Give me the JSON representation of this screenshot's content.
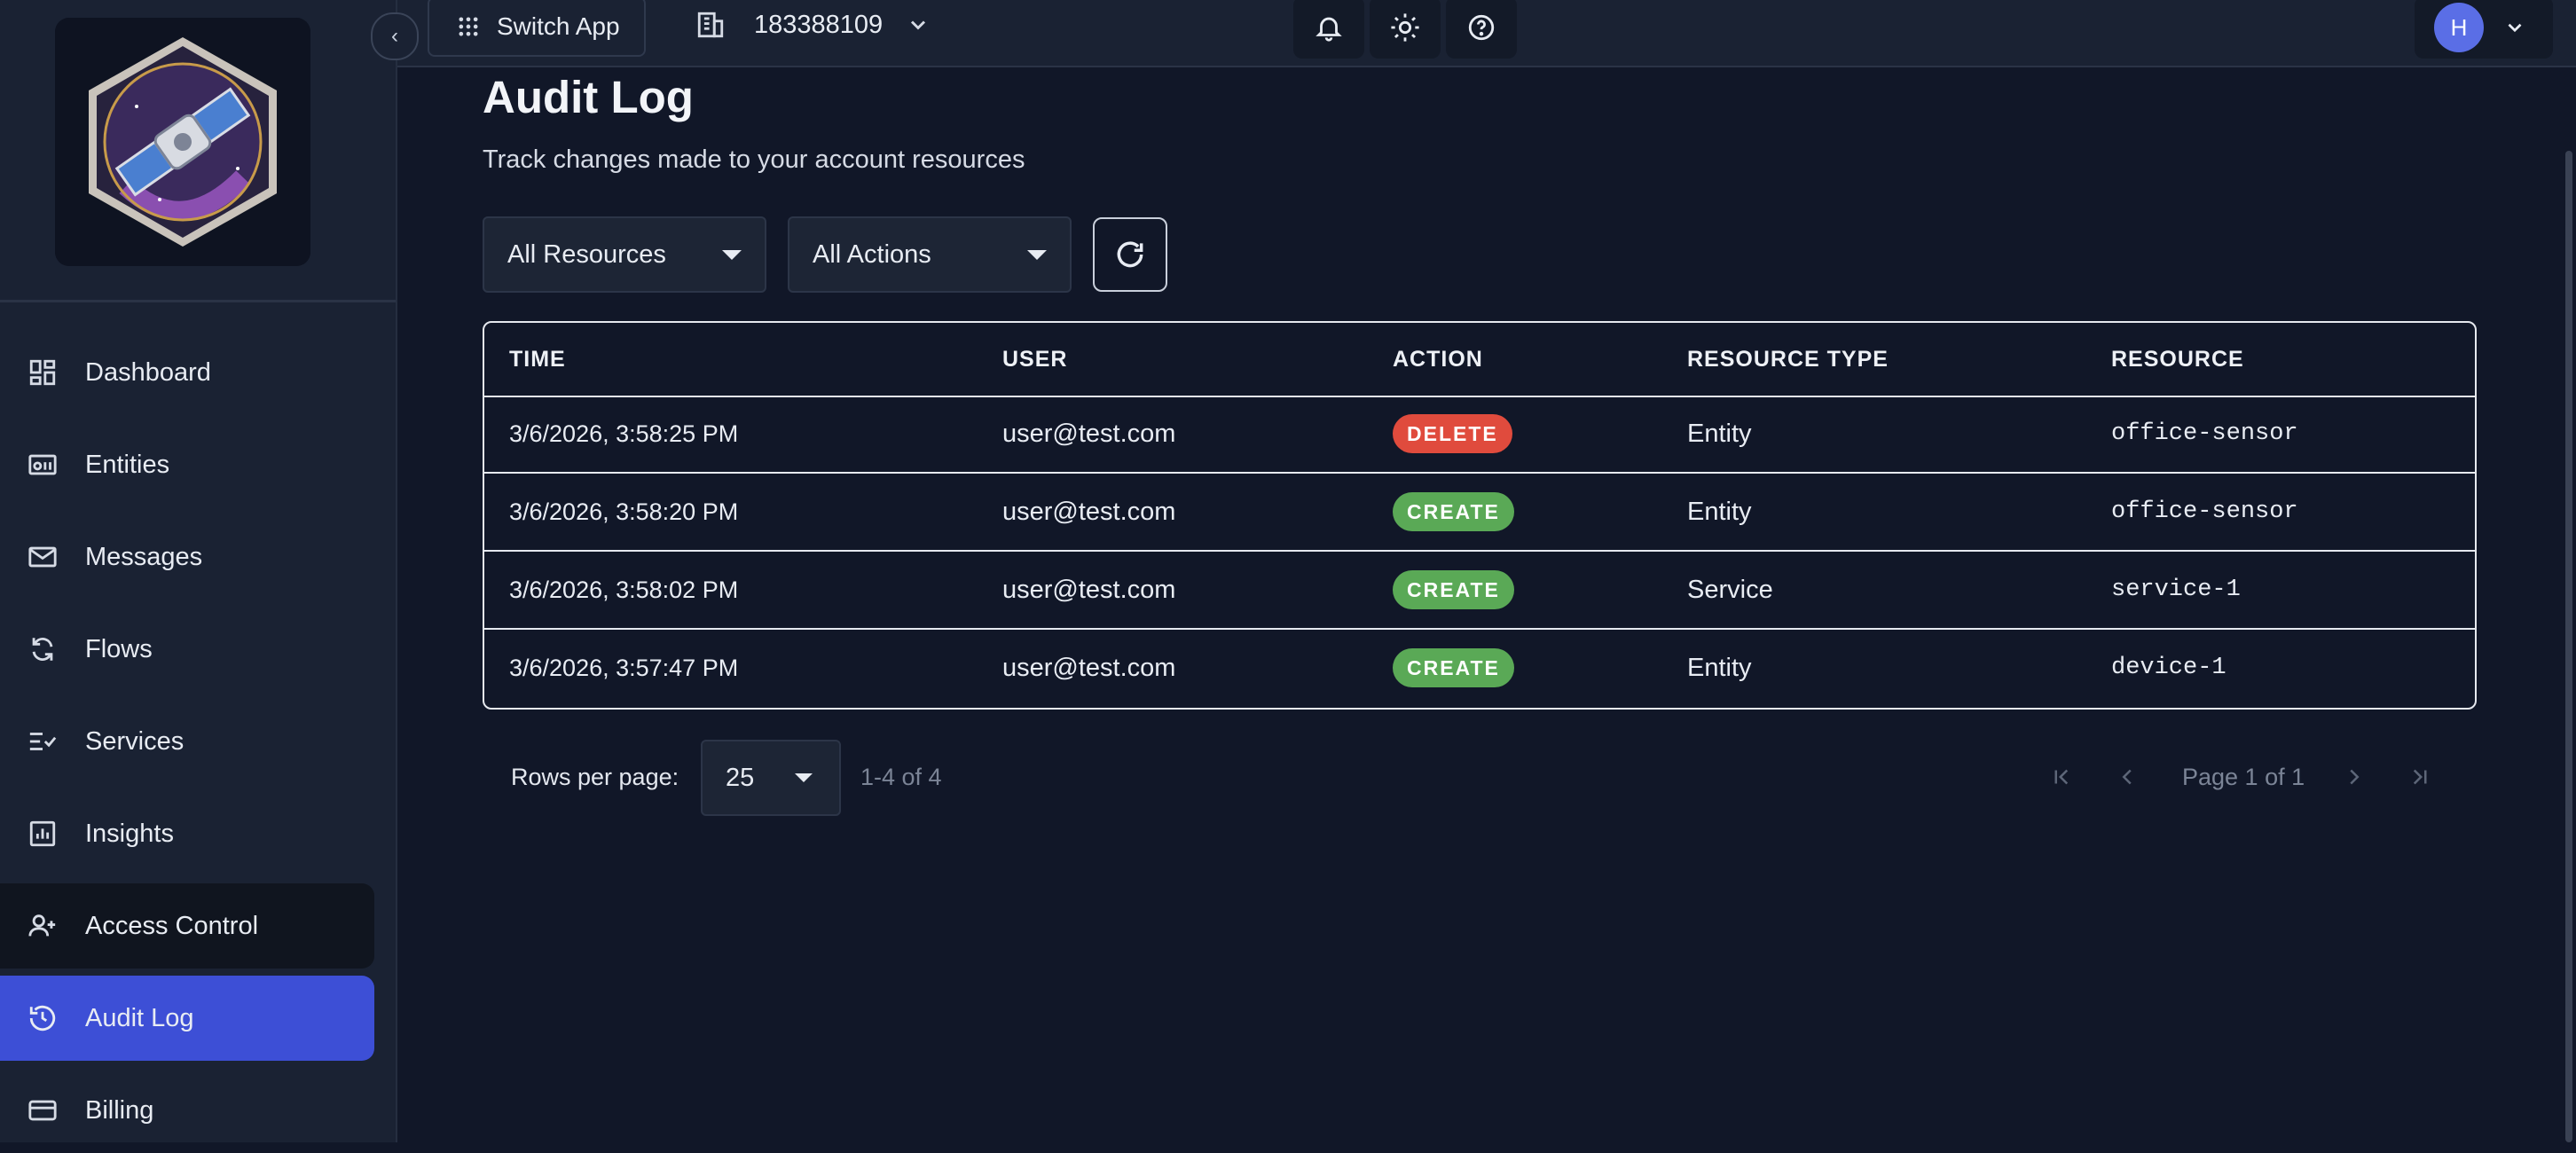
{
  "colors": {
    "background": "#111728",
    "sidebar": "#1a2233",
    "active_nav": "#3d4fd6",
    "delete_badge": "#e04b3d",
    "create_badge": "#5aa956",
    "avatar": "#5a6ee6"
  },
  "topbar": {
    "switch_app_label": "Switch App",
    "org_id": "183388109",
    "avatar_initial": "H"
  },
  "sidebar": {
    "items": [
      {
        "label": "Dashboard",
        "icon": "dashboard-icon"
      },
      {
        "label": "Entities",
        "icon": "entities-icon"
      },
      {
        "label": "Messages",
        "icon": "mail-icon"
      },
      {
        "label": "Flows",
        "icon": "flows-icon"
      },
      {
        "label": "Services",
        "icon": "services-icon"
      },
      {
        "label": "Insights",
        "icon": "insights-icon"
      },
      {
        "label": "Access Control",
        "icon": "access-control-icon"
      },
      {
        "label": "Audit Log",
        "icon": "history-icon"
      },
      {
        "label": "Billing",
        "icon": "credit-card-icon"
      }
    ]
  },
  "main": {
    "title": "Audit Log",
    "subtitle": "Track changes made to your account resources",
    "filters": {
      "resource": "All Resources",
      "action": "All Actions"
    },
    "table": {
      "headers": [
        "TIME",
        "USER",
        "ACTION",
        "RESOURCE TYPE",
        "RESOURCE"
      ],
      "rows": [
        {
          "time": "3/6/2026, 3:58:25 PM",
          "user": "user@test.com",
          "action": "DELETE",
          "resource_type": "Entity",
          "resource": "office-sensor"
        },
        {
          "time": "3/6/2026, 3:58:20 PM",
          "user": "user@test.com",
          "action": "CREATE",
          "resource_type": "Entity",
          "resource": "office-sensor"
        },
        {
          "time": "3/6/2026, 3:58:02 PM",
          "user": "user@test.com",
          "action": "CREATE",
          "resource_type": "Service",
          "resource": "service-1"
        },
        {
          "time": "3/6/2026, 3:57:47 PM",
          "user": "user@test.com",
          "action": "CREATE",
          "resource_type": "Entity",
          "resource": "device-1"
        }
      ]
    },
    "pagination": {
      "rows_per_page_label": "Rows per page:",
      "rows_per_page": "25",
      "range": "1-4 of 4",
      "page": "Page 1 of 1"
    }
  }
}
